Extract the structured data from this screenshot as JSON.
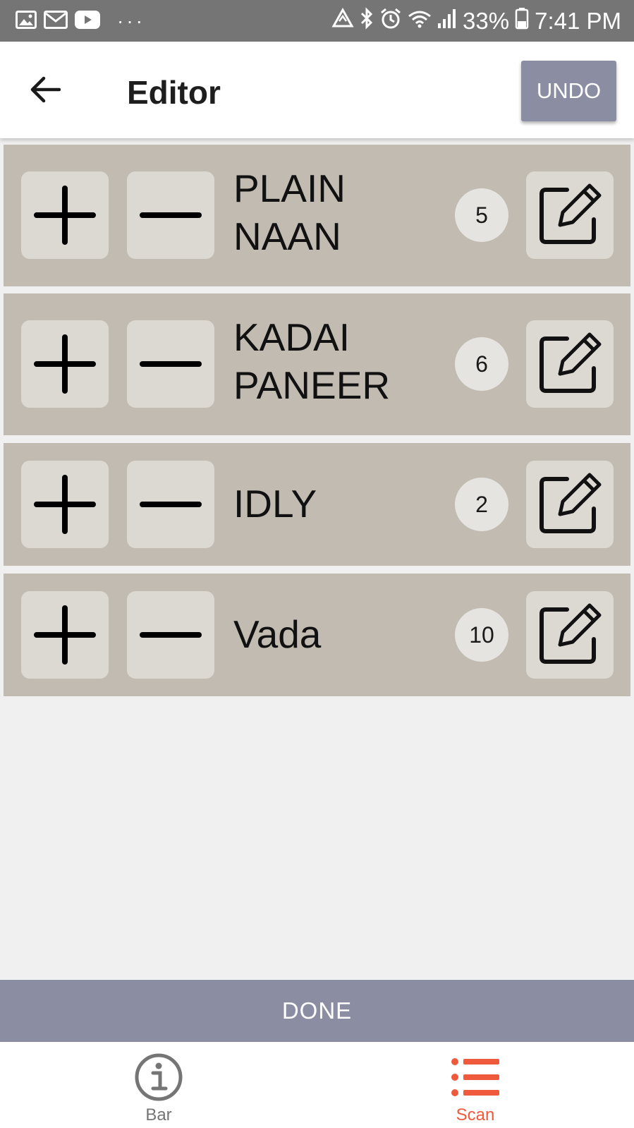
{
  "status_bar": {
    "battery_percent": "33%",
    "time": "7:41 PM",
    "overflow": "···",
    "icons": [
      "gallery-icon",
      "gmail-icon",
      "youtube-icon",
      "data-saver-icon",
      "bluetooth-icon",
      "alarm-icon",
      "wifi-icon",
      "signal-icon",
      "battery-icon"
    ]
  },
  "app_bar": {
    "title": "Editor",
    "undo_label": "UNDO"
  },
  "items": [
    {
      "name": "PLAIN\nNAAN",
      "count": "5"
    },
    {
      "name": "KADAI\nPANEER",
      "count": "6"
    },
    {
      "name": "IDLY",
      "count": "2"
    },
    {
      "name": "Vada",
      "count": "10"
    }
  ],
  "done_label": "DONE",
  "bottom_nav": {
    "items": [
      {
        "label": "Bar",
        "icon": "info-icon",
        "active": false
      },
      {
        "label": "Scan",
        "icon": "list-icon",
        "active": true
      }
    ]
  },
  "colors": {
    "accent_button": "#8b8da3",
    "row_background": "#c1bbb1",
    "active_nav": "#f05a3c",
    "inactive_nav": "#757575"
  }
}
